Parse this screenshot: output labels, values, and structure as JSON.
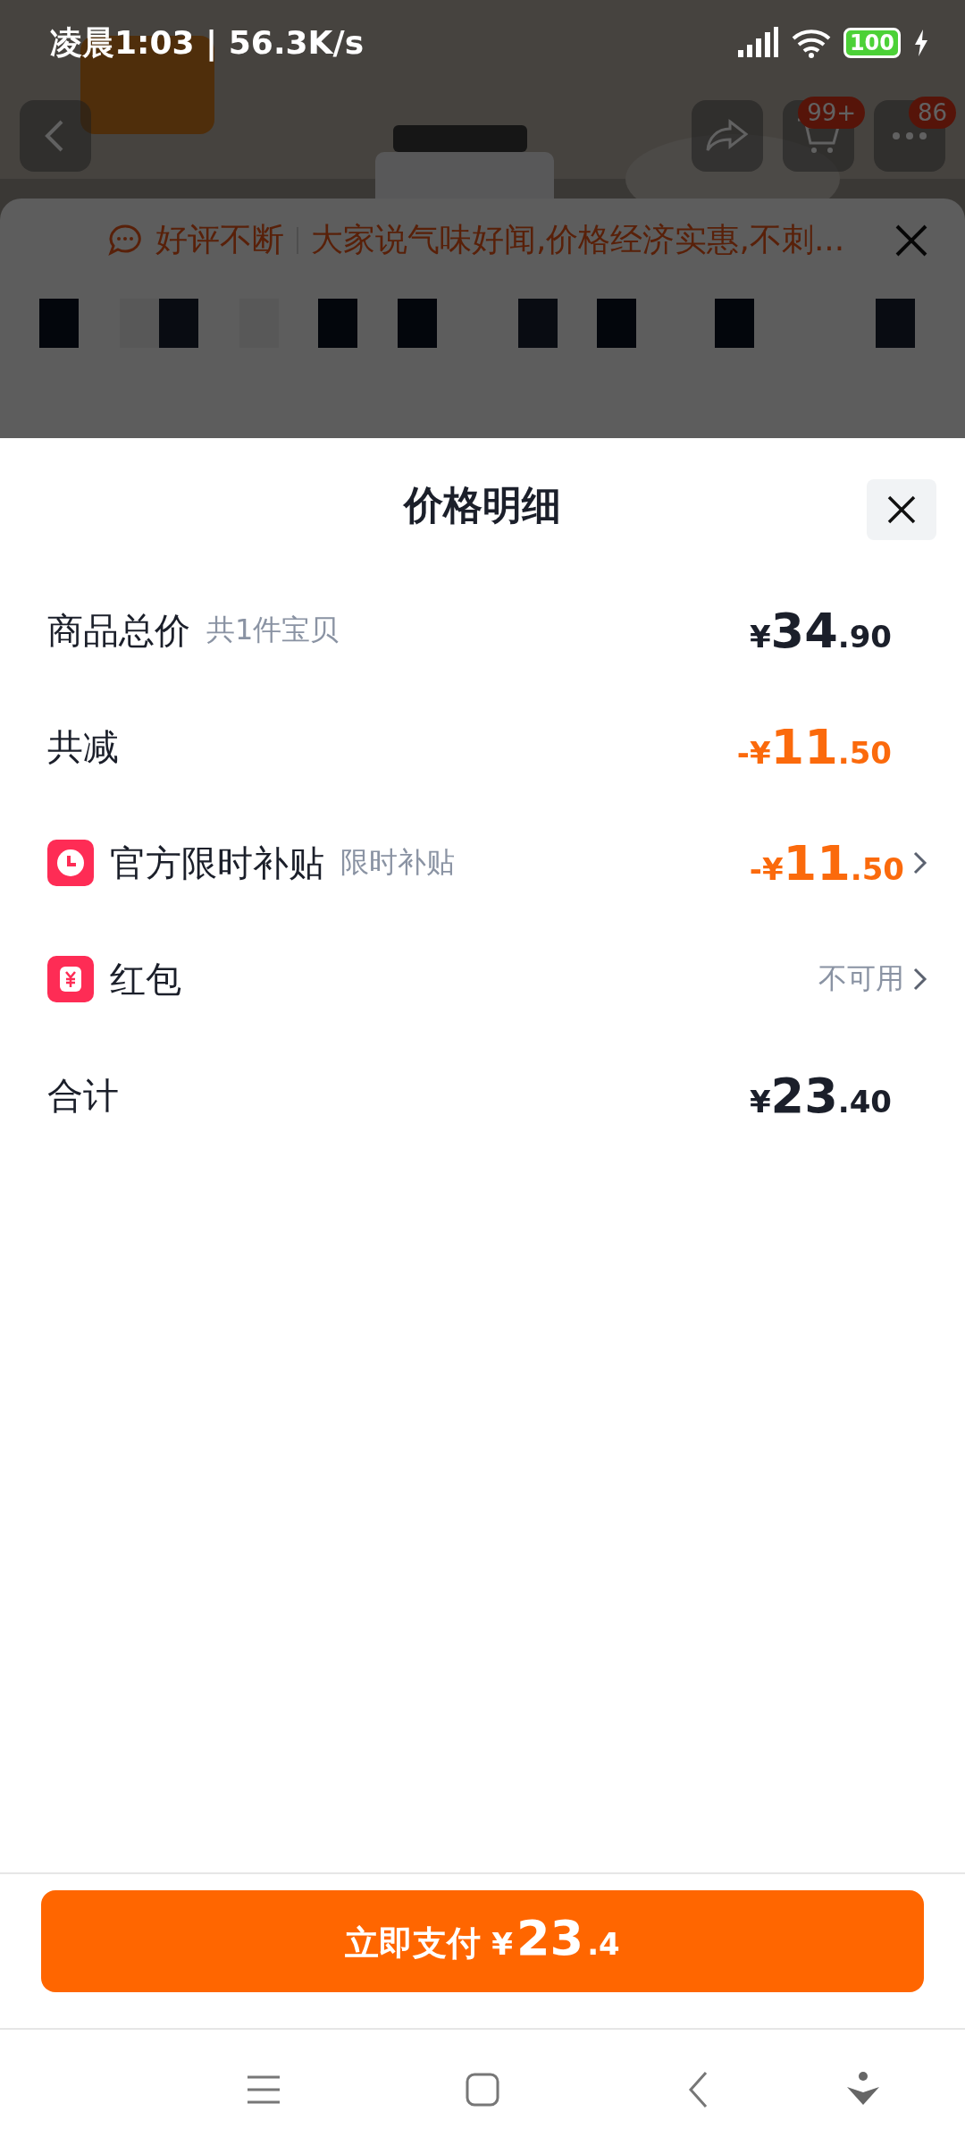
{
  "status_bar": {
    "time": "凌晨1:03",
    "separator": "|",
    "speed": "56.3K/s",
    "battery": "100"
  },
  "background_page": {
    "cart_badge": "99+",
    "more_badge": "86",
    "sku_sheet": {
      "tag": "好评不断",
      "review": "大家说气味好闻,价格经济实惠,不刺..."
    }
  },
  "price_sheet": {
    "title": "价格明细",
    "rows": [
      {
        "kind": "plain",
        "label": "商品总价",
        "note": "共1件宝贝",
        "price": {
          "currency": "¥",
          "integer": "34",
          "decimal": ".90"
        },
        "discount": false,
        "expandable": false
      },
      {
        "kind": "plain",
        "label": "共减",
        "price": {
          "sign": "-",
          "currency": "¥",
          "integer": "11",
          "decimal": ".50"
        },
        "discount": true,
        "expandable": false
      },
      {
        "kind": "subsidy",
        "label": "官方限时补贴",
        "note": "限时补贴",
        "price": {
          "sign": "-",
          "currency": "¥",
          "integer": "11",
          "decimal": ".50"
        },
        "discount": true,
        "expandable": true
      },
      {
        "kind": "red_packet",
        "label": "红包",
        "status": "不可用",
        "expandable": true
      },
      {
        "kind": "plain",
        "label": "合计",
        "price": {
          "currency": "¥",
          "integer": "23",
          "decimal": ".40"
        },
        "discount": false,
        "expandable": false
      }
    ]
  },
  "pay_button": {
    "label": "立即支付",
    "currency": "¥",
    "integer": "23",
    "decimal": ".4"
  }
}
